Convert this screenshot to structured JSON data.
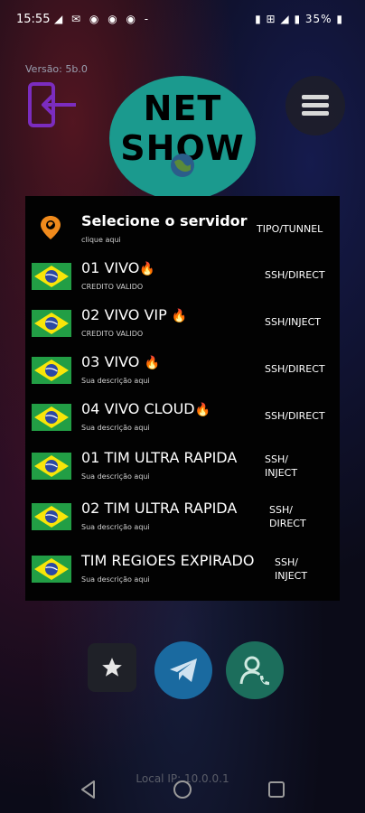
{
  "status_bar": {
    "time": "15:55",
    "left_icons": "◢ ✉ ◉ ◉ ◉ -",
    "battery": "35%",
    "signal_icons": "▮ ⊞ ◢ ▮"
  },
  "version": "Versão: 5b.0",
  "logo": {
    "line1": "NET",
    "line2": "SHOW"
  },
  "header_row": {
    "title": "Selecione o servidor",
    "subtitle": "clique aqui",
    "type": "TIPO/TUNNEL",
    "icon": "location-pin-icon"
  },
  "servers": [
    {
      "name": "01 VIVO",
      "flame": "🔥",
      "description": "CREDITO VALIDO",
      "type_line1": "SSH/DIRECT",
      "type_line2": ""
    },
    {
      "name": "02 VIVO VIP",
      "flame": "🔥",
      "description": "CREDITO VALIDO",
      "type_line1": "SSH/INJECT",
      "type_line2": ""
    },
    {
      "name": "03 VIVO",
      "flame": "🔥",
      "description": "Sua descrição aqui",
      "type_line1": "SSH/DIRECT",
      "type_line2": ""
    },
    {
      "name": "04 VIVO CLOUD",
      "flame": "🔥",
      "description": "Sua descrição aqui",
      "type_line1": "SSH/DIRECT",
      "type_line2": ""
    },
    {
      "name": "01  TIM ULTRA RAPIDA",
      "flame": "",
      "description": "Sua descrição aqui",
      "type_line1": "SSH/",
      "type_line2": "INJECT"
    },
    {
      "name": "02  TIM ULTRA RAPIDA",
      "flame": "",
      "description": "Sua descrição aqui",
      "type_line1": "SSH/",
      "type_line2": "DIRECT"
    },
    {
      "name": "TIM REGIOES EXPIRADO",
      "flame": "",
      "description": "Sua descrição aqui",
      "type_line1": "SSH/",
      "type_line2": "INJECT"
    }
  ],
  "bottom": {
    "favorite_icon": "star-icon",
    "telegram_icon": "telegram-icon",
    "user_icon": "user-phone-icon"
  },
  "local_ip": "Local IP: 10.0.0.1",
  "colors": {
    "logo_bg": "#1b9a8e",
    "exit_icon": "#7b2cbf",
    "telegram_bg": "#1a6aa0",
    "user_bg": "#1c6e5c",
    "pin_icon": "#f08a1c"
  }
}
